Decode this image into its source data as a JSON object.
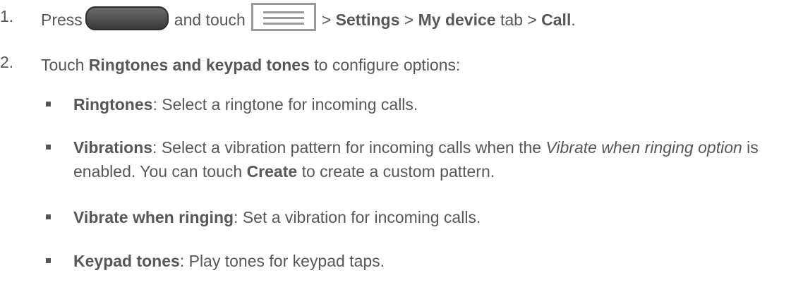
{
  "steps": [
    {
      "number": "1.",
      "press": "Press",
      "and_touch": "and touch",
      "sep1": ">",
      "settings": "Settings",
      "sep2": ">",
      "my_device": "My device",
      "tab": "tab",
      "sep3": ">",
      "call": "Call",
      "end": "."
    },
    {
      "number": "2.",
      "touch": "Touch",
      "ringtones_keypad": "Ringtones and keypad tones",
      "rest": "to configure options:"
    }
  ],
  "options": [
    {
      "term": "Ringtones",
      "colon": ":",
      "desc": "Select a ringtone for incoming calls."
    },
    {
      "term": "Vibrations",
      "colon": ":",
      "desc_a": "Select a vibration pattern for incoming calls when the",
      "desc_italic": "Vibrate when ringing option",
      "desc_b": "is enabled. You can touch",
      "create": "Create",
      "desc_c": "to create a custom pattern."
    },
    {
      "term": "Vibrate when ringing",
      "colon": ":",
      "desc": "Set a vibration for incoming calls."
    },
    {
      "term": "Keypad tones",
      "colon": ":",
      "desc": "Play tones for keypad taps."
    }
  ],
  "icons": {
    "home_key": "home-key-icon",
    "menu_key": "menu-key-icon"
  },
  "colors": {
    "text": "#575757",
    "icon_border": "#9a9a9a"
  }
}
